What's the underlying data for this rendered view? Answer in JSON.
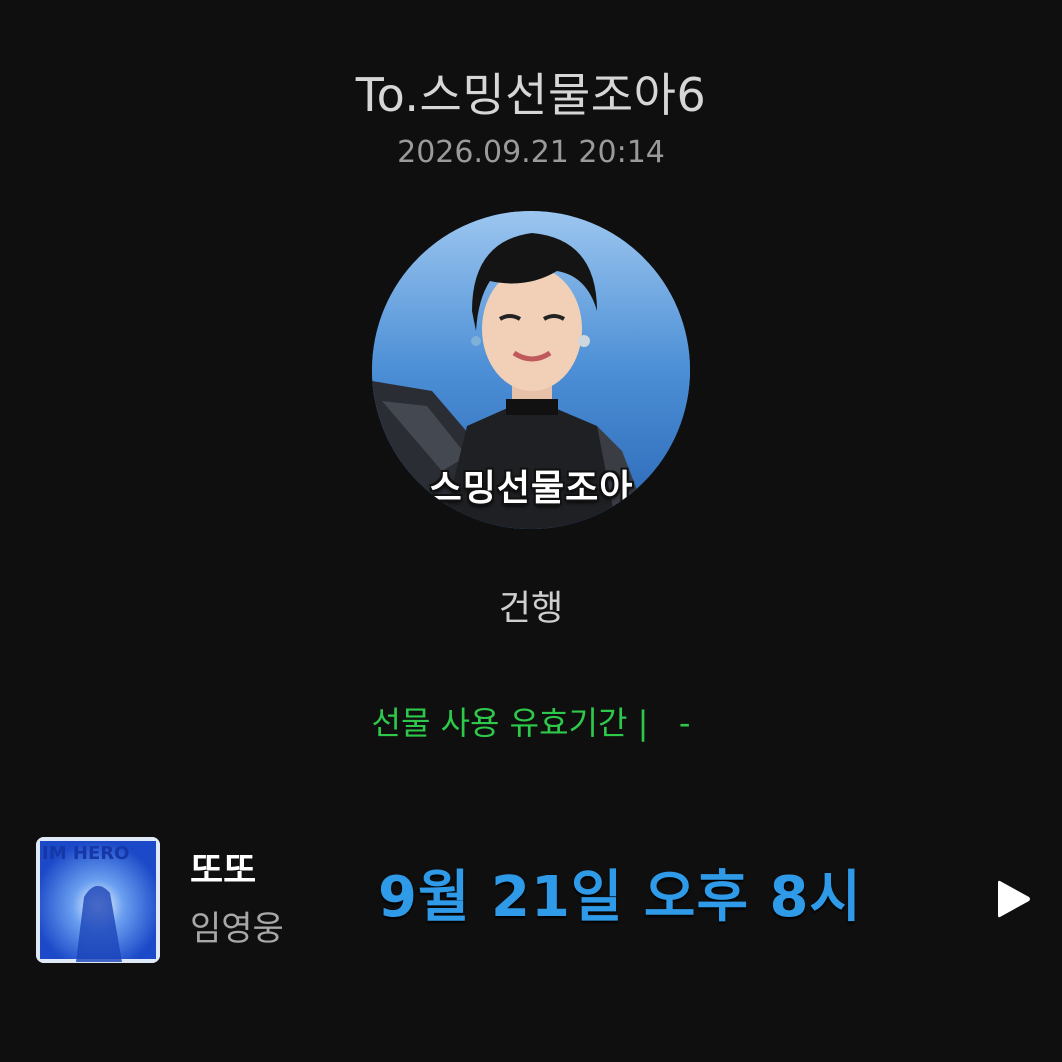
{
  "header": {
    "title": "To.스밍선물조아6",
    "datetime": "2026.09.21 20:14"
  },
  "profile": {
    "caption": "스밍선물조아",
    "icon": "profile-photo"
  },
  "gift": {
    "name": "건행",
    "validity": "선물 사용 유효기간 |   -"
  },
  "music": {
    "title": "또또",
    "artist": "임영웅",
    "album_art_text": "IM HERO",
    "play_icon": "play-icon"
  },
  "overlay": {
    "text": "9월 21일 오후 8시"
  },
  "colors": {
    "background": "#0f0f0f",
    "validity_green": "#2ec84a",
    "overlay_blue": "#2f9be8"
  }
}
